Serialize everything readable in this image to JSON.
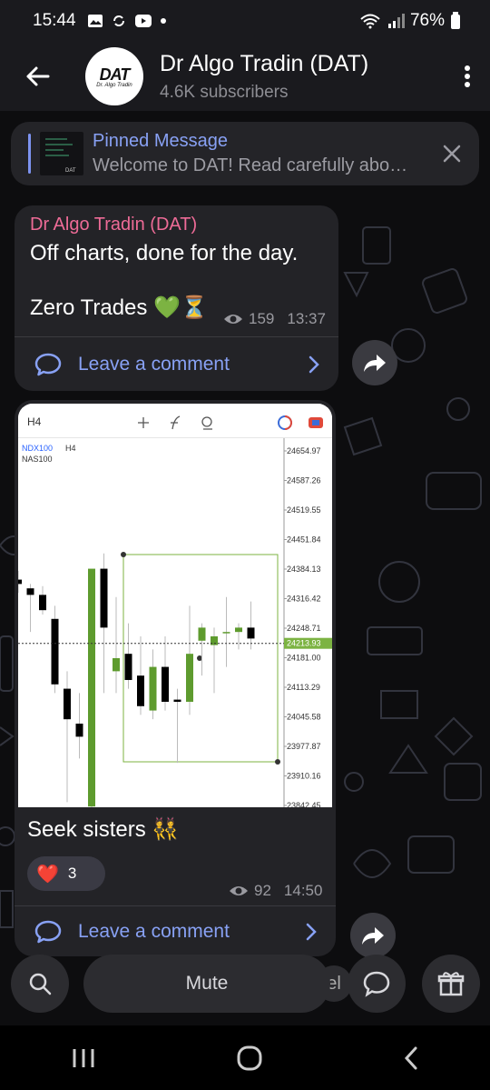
{
  "status_bar": {
    "time": "15:44",
    "battery": "76%"
  },
  "channel": {
    "name": "Dr Algo Tradin (DAT)",
    "subscribers": "4.6K subscribers",
    "avatar_logo": "DAT",
    "avatar_sub": "Dr. Algo Tradin"
  },
  "pinned": {
    "title": "Pinned Message",
    "text": "Welcome to DAT!  Read carefully abo…"
  },
  "message1": {
    "sender": "Dr Algo Tradin (DAT)",
    "line1": "Off charts, done for the day.",
    "line2": "Zero Trades 💚⏳",
    "views": "159",
    "time": "13:37",
    "comment_label": "Leave a comment"
  },
  "message2": {
    "caption": "Seek sisters 👯",
    "reaction_emoji": "❤️",
    "reaction_count": "3",
    "views": "92",
    "time": "14:50",
    "comment_label": "Leave a comment",
    "chart": {
      "timeframe": "H4",
      "symbol": "NDX100",
      "symbol_tf": "H4",
      "symbol_desc": "NAS100",
      "current_price": "24213.93"
    }
  },
  "chart_data": {
    "type": "candlestick",
    "title": "NDX100 · H4",
    "ylabels": [
      "24654.97",
      "24587.26",
      "24519.55",
      "24451.84",
      "24384.13",
      "24316.42",
      "24248.71",
      "24181.00",
      "24113.29",
      "24045.58",
      "23977.87",
      "23910.16",
      "23842.45"
    ],
    "ylim": [
      23842.45,
      24654.97
    ],
    "last_price": 24213.93,
    "candles": [
      {
        "o": 24360,
        "h": 24380,
        "l": 24330,
        "c": 24350
      },
      {
        "o": 24340,
        "h": 24350,
        "l": 24240,
        "c": 24325
      },
      {
        "o": 24325,
        "h": 24345,
        "l": 24280,
        "c": 24290
      },
      {
        "o": 24270,
        "h": 24300,
        "l": 24100,
        "c": 24120
      },
      {
        "o": 24110,
        "h": 24150,
        "l": 23850,
        "c": 24040
      },
      {
        "o": 24030,
        "h": 24100,
        "l": 23950,
        "c": 24000
      },
      {
        "o": 23840,
        "h": 24380,
        "l": 23820,
        "c": 24385
      },
      {
        "o": 24385,
        "h": 24420,
        "l": 24100,
        "c": 24250
      },
      {
        "o": 24150,
        "h": 24320,
        "l": 24100,
        "c": 24180
      },
      {
        "o": 24190,
        "h": 24260,
        "l": 24110,
        "c": 24130
      },
      {
        "o": 24140,
        "h": 24230,
        "l": 24050,
        "c": 24070
      },
      {
        "o": 24060,
        "h": 24200,
        "l": 24040,
        "c": 24160
      },
      {
        "o": 24160,
        "h": 24230,
        "l": 24060,
        "c": 24080
      },
      {
        "o": 24085,
        "h": 24110,
        "l": 23940,
        "c": 24080
      },
      {
        "o": 24080,
        "h": 24300,
        "l": 24050,
        "c": 24190
      },
      {
        "o": 24220,
        "h": 24260,
        "l": 24140,
        "c": 24250
      },
      {
        "o": 24210,
        "h": 24250,
        "l": 24100,
        "c": 24230
      },
      {
        "o": 24240,
        "h": 24320,
        "l": 24160,
        "c": 24240
      },
      {
        "o": 24240,
        "h": 24260,
        "l": 24200,
        "c": 24250
      },
      {
        "o": 24250,
        "h": 24310,
        "l": 24200,
        "c": 24225
      }
    ]
  },
  "composer": {
    "mute_label": "Mute",
    "side_label": "el"
  },
  "colors": {
    "bubble": "#232327",
    "accent": "#88a1f4",
    "sender": "#ee6b97",
    "bull": "#5e9b2e",
    "bear": "#000000"
  }
}
